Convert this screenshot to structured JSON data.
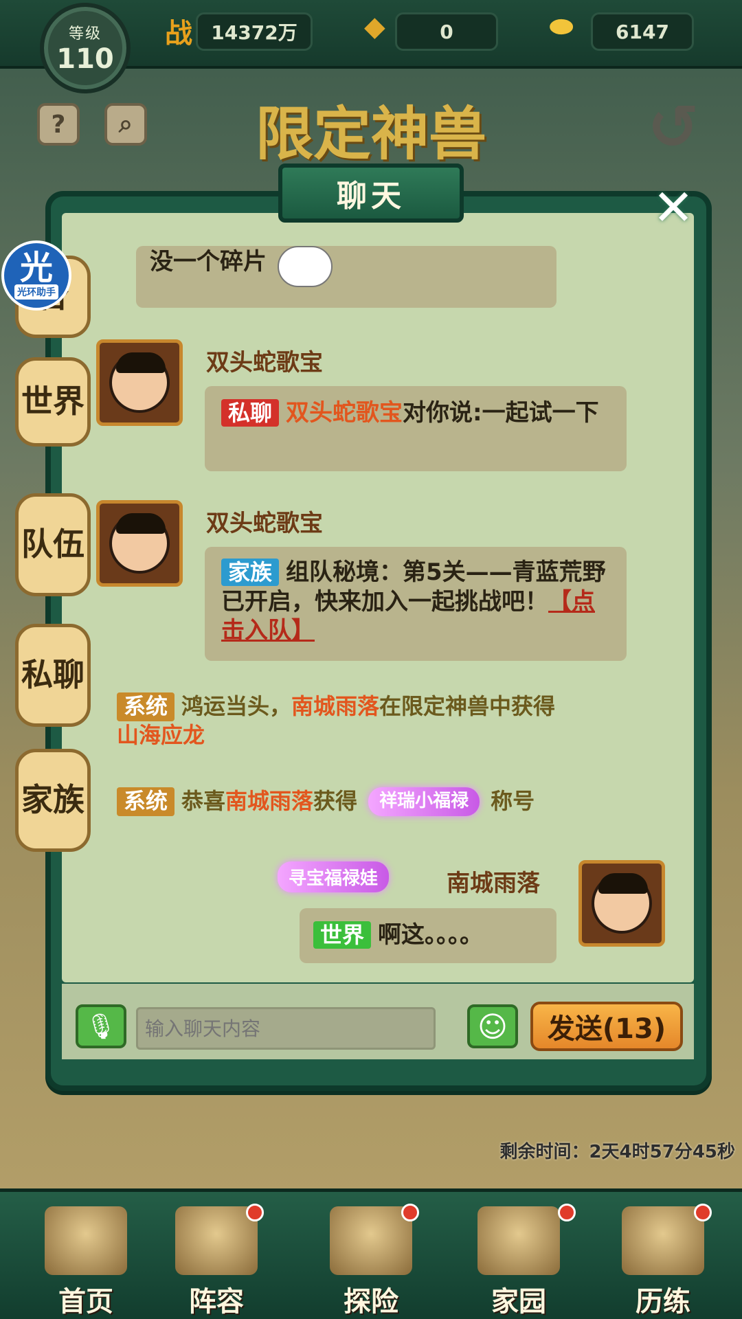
{
  "topbar": {
    "level_label": "等级",
    "level_value": "110",
    "power_icon": "战",
    "power_value": "14372万",
    "coin_value": "0",
    "ingot_value": "6147"
  },
  "scene": {
    "title": "限定神兽",
    "help_icon": "?",
    "search_icon": "⌕",
    "back_icon": "↺"
  },
  "assistant": {
    "glyph": "光",
    "label": "光环助手"
  },
  "chat": {
    "title": "聊天",
    "close": "✕",
    "side_tabs": [
      "合",
      "世界",
      "队伍",
      "私聊",
      "家族"
    ],
    "messages": {
      "top_bubble_text": "没一个碎片",
      "msg1_name": "双头蛇歌宝",
      "msg1_tag": "私聊",
      "msg1_sender": "双头蛇歌宝",
      "msg1_text": "对你说:一起试一下",
      "msg2_name": "双头蛇歌宝",
      "msg2_tag": "家族",
      "msg2_text": "组队秘境：第5关——青蓝荒野已开启，快来加入一起挑战吧！",
      "msg2_link": "【点击入队】",
      "sys1_tag": "系统",
      "sys1_text_a": "鸿运当头，",
      "sys1_player": "南城雨落",
      "sys1_text_b": "在限定神兽中获得",
      "sys1_item": "山海应龙",
      "sys2_tag": "系统",
      "sys2_text_a": "恭喜",
      "sys2_player": "南城雨落",
      "sys2_text_b": "获得",
      "sys2_badge": "祥瑞小福禄",
      "sys2_text_c": "称号",
      "self_badge": "寻宝福禄娃",
      "self_name": "南城雨落",
      "self_tag": "世界",
      "self_text": "啊这。。。。"
    },
    "input_placeholder": "输入聊天内容",
    "send_label": "发送(13)"
  },
  "event": {
    "remaining_time": "剩余时间：2天4时57分45秒"
  },
  "nav": {
    "items": [
      "首页",
      "阵容",
      "探险",
      "家园",
      "历练"
    ]
  }
}
